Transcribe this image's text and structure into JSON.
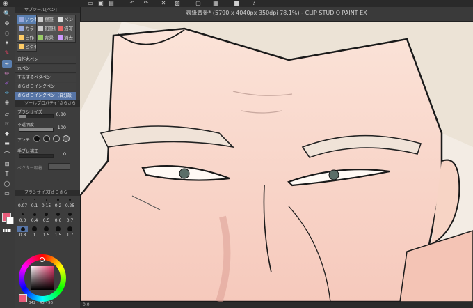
{
  "title": "表紙背景* (5790 x 4040px 350dpi 78.1%) - CLIP STUDIO PAINT EX",
  "subtool_panel": {
    "header": "サブツール[ペン]",
    "tabs": [
      {
        "label": "いつも",
        "icon": "pen-nib-icon",
        "active": true
      },
      {
        "label": "擦筆",
        "icon": "blend-icon",
        "active": false
      },
      {
        "label": "ペン",
        "icon": "pen-icon",
        "active": false
      },
      {
        "label": "カラ",
        "icon": "color-pen-icon",
        "active": false
      },
      {
        "label": "鉛筆線画",
        "icon": "pencil-icon",
        "active": false
      },
      {
        "label": "描写",
        "icon": "draw-icon",
        "active": false
      },
      {
        "label": "自作",
        "icon": "custom-icon",
        "active": false
      },
      {
        "label": "背景",
        "icon": "background-icon",
        "active": false
      },
      {
        "label": "消去",
        "icon": "eraser-icon",
        "active": false
      },
      {
        "label": "ピクセ",
        "icon": "pixel-icon",
        "active": false
      }
    ],
    "brushes": [
      "自作丸ペン",
      "丸ペン",
      "するするベタペン",
      "さらさらインクペン",
      "さらさらインクペン（自分設定）"
    ],
    "selected_brush_index": 4
  },
  "tool_property": {
    "header": "ツールプロパティ[さらさら",
    "brush_size_label": "ブラシサイズ",
    "brush_size_value": "0.80",
    "opacity_label": "不透明度",
    "opacity_value": "100",
    "anti_alias_label": "アンチ",
    "stabilization_label": "手ブレ補正",
    "stabilization_value": "0",
    "vector_label": "ベクター吸着"
  },
  "brush_size_panel": {
    "header": "ブラシサイズ[さらさら",
    "sizes": [
      "0.07",
      "0.1",
      "0.15",
      "0.2",
      "0.25",
      "0.3",
      "0.4",
      "0.5",
      "0.6",
      "0.7",
      "0.8",
      "1",
      "1.5",
      "1.5",
      "1.7"
    ],
    "selected_index": 10
  },
  "color": {
    "main": "#e85b7a",
    "secondary": "#ffffff",
    "wheel_readout": "342 · 45 · 96"
  },
  "colors": {
    "accent": "#5a7fb0",
    "canvas_skin": "#f6d7cc",
    "hair": "#e9e1d5"
  },
  "status": {
    "zoom": "0.0"
  }
}
